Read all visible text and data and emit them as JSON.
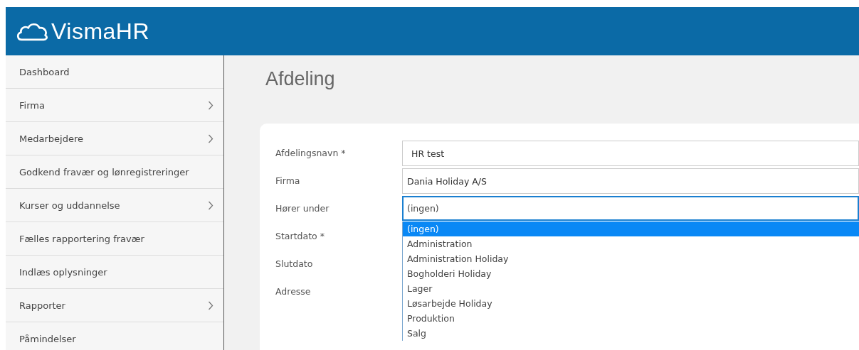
{
  "header": {
    "logo": "VismaHR"
  },
  "sidebar": {
    "items": [
      {
        "label": "Dashboard",
        "has_submenu": false
      },
      {
        "label": "Firma",
        "has_submenu": true
      },
      {
        "label": "Medarbejdere",
        "has_submenu": true
      },
      {
        "label": "Godkend fravær og lønregistreringer",
        "has_submenu": false
      },
      {
        "label": "Kurser og uddannelse",
        "has_submenu": true
      },
      {
        "label": "Fælles rapportering fravær",
        "has_submenu": false
      },
      {
        "label": "Indlæs oplysninger",
        "has_submenu": false
      },
      {
        "label": "Rapporter",
        "has_submenu": true
      },
      {
        "label": "Påmindelser",
        "has_submenu": false
      }
    ]
  },
  "page": {
    "title": "Afdeling"
  },
  "form": {
    "fields": [
      {
        "label": "Afdelingsnavn *",
        "kind": "input",
        "value": "HR test"
      },
      {
        "label": "Firma",
        "kind": "readonly",
        "value": "Dania Holiday A/S"
      },
      {
        "label": "Hører under",
        "kind": "select",
        "value": "(ingen)",
        "options": [
          {
            "label": "(ingen)",
            "selected": true
          },
          {
            "label": "Administration",
            "selected": false
          },
          {
            "label": "Administration Holiday",
            "selected": false
          },
          {
            "label": "Bogholderi Holiday",
            "selected": false
          },
          {
            "label": "Lager",
            "selected": false
          },
          {
            "label": "Løsarbejde Holiday",
            "selected": false
          },
          {
            "label": "Produktion",
            "selected": false
          },
          {
            "label": "Salg",
            "selected": false
          }
        ]
      },
      {
        "label": "Startdato *",
        "kind": "label"
      },
      {
        "label": "Slutdato",
        "kind": "label"
      },
      {
        "label": "Adresse",
        "kind": "label"
      }
    ]
  }
}
